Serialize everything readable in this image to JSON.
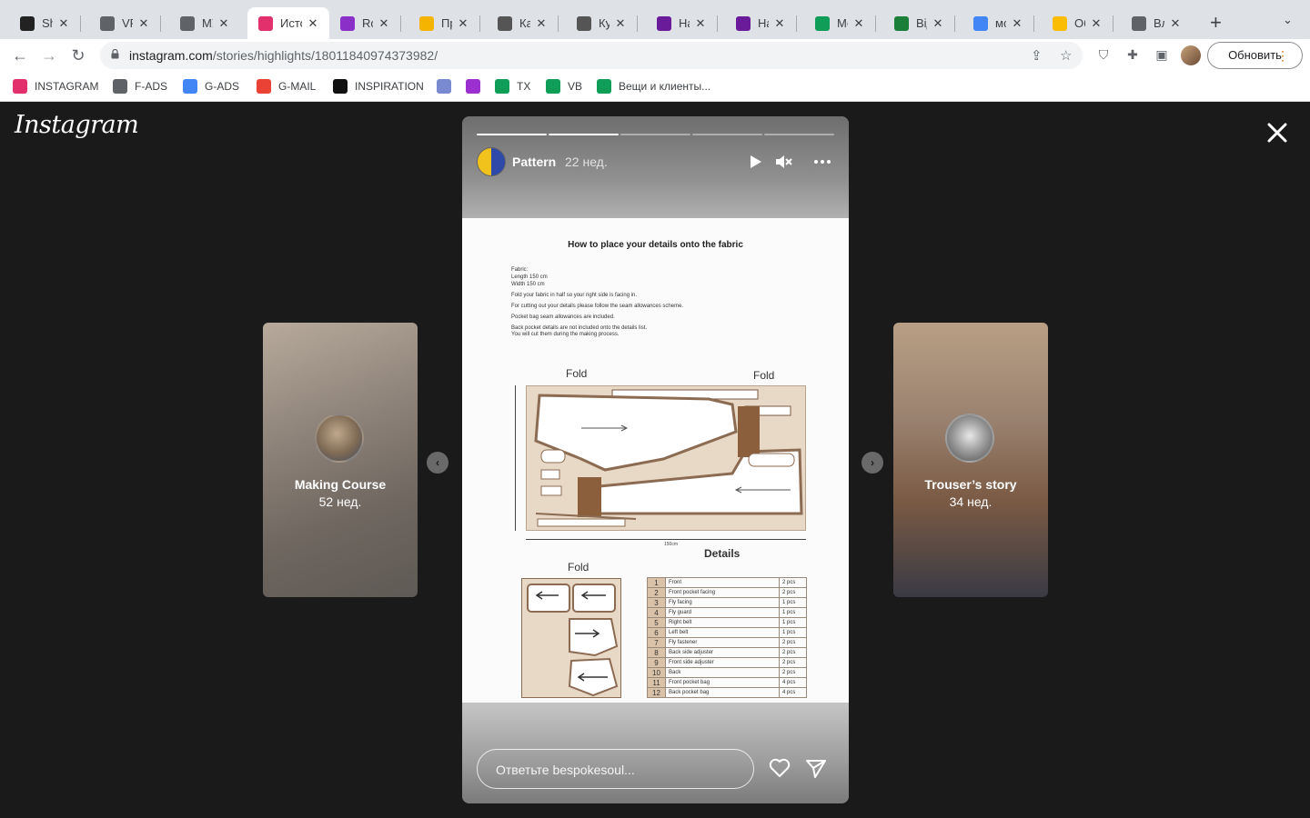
{
  "tabs": [
    {
      "title": "Shopify",
      "favicon": "shopify-icon",
      "color": "#222222"
    },
    {
      "title": "VFS",
      "favicon": "globe-icon",
      "color": "#5f6368"
    },
    {
      "title": "МУЖ",
      "favicon": "mic-icon",
      "color": "#5f6368"
    },
    {
      "title": "Истории",
      "favicon": "instagram-icon",
      "color": "#e1306c"
    },
    {
      "title": "Rok",
      "favicon": "rok-icon",
      "color": "#8b2fc9"
    },
    {
      "title": "Про",
      "favicon": "drive-icon",
      "color": "#f4b400"
    },
    {
      "title": "Кат",
      "favicon": "atk-icon",
      "color": "#555555"
    },
    {
      "title": "Куп",
      "favicon": "atk-icon",
      "color": "#555555"
    },
    {
      "title": "Нат",
      "favicon": "square-icon",
      "color": "#6a1b9a"
    },
    {
      "title": "Нат",
      "favicon": "square-icon",
      "color": "#6a1b9a"
    },
    {
      "title": "Мой",
      "favicon": "drive-icon",
      "color": "#0f9d58"
    },
    {
      "title": "Відг",
      "favicon": "leaf-icon",
      "color": "#1b7f3a"
    },
    {
      "title": "мош",
      "favicon": "google-icon",
      "color": "#4285f4"
    },
    {
      "title": "Объ",
      "favicon": "ads-icon",
      "color": "#fbbc04"
    },
    {
      "title": "Вла",
      "favicon": "globe-icon",
      "color": "#5f6368"
    }
  ],
  "address": {
    "host": "instagram.com",
    "path": "/stories/highlights/18011840974373982/"
  },
  "toolbar": {
    "update_label": "Обновить"
  },
  "bookmarks": [
    {
      "label": "INSTAGRAM",
      "icon": "instagram-icon",
      "color": "#e1306c"
    },
    {
      "label": "F-ADS",
      "icon": "fads-icon",
      "color": "#5f6368"
    },
    {
      "label": "G-ADS",
      "icon": "google-ads-icon",
      "color": "#4285f4"
    },
    {
      "label": "G-MAIL",
      "icon": "gmail-icon",
      "color": "#ea4335"
    },
    {
      "label": "INSPIRATION",
      "icon": "behance-icon",
      "color": "#111111"
    },
    {
      "label": "",
      "icon": "info-icon",
      "color": "#7a8ad0"
    },
    {
      "label": "",
      "icon": "bookmark-icon",
      "color": "#9b2fd0"
    },
    {
      "label": "TX",
      "icon": "drive-icon",
      "color": "#0f9d58"
    },
    {
      "label": "VB",
      "icon": "drive-icon",
      "color": "#0f9d58"
    },
    {
      "label": "Вещи и клиенты...",
      "icon": "sheets-icon",
      "color": "#0f9d58"
    }
  ],
  "viewer": {
    "logo": "Instagram",
    "left_story": {
      "name": "Making Course",
      "time": "52 нед."
    },
    "right_story": {
      "name": "Trouser’s story",
      "time": "34 нед."
    },
    "story": {
      "username": "Pattern",
      "time": "22 нед.",
      "progress_total": 5,
      "progress_done": 2,
      "reply_placeholder": "Ответьте bespokesoul..."
    }
  },
  "document": {
    "title": "How to place your details onto the fabric",
    "fabric": "Fabric:\nLength 150 cm\nWidth 150 cm",
    "instructions": [
      "Fold your fabric in half so your right side is facing in.",
      "For cutting out your details please follow the seam allowances scheme.",
      "Pocket bag seam allowances are included.",
      "Back pocket details are not included onto the details list.\nYou will cut them during the making process."
    ],
    "fold_labels": [
      "Fold",
      "Fold",
      "Fold"
    ],
    "width_label": "150cm",
    "details_title": "Details",
    "details": [
      {
        "n": "1",
        "name": "Front",
        "qty": "2 pcs"
      },
      {
        "n": "2",
        "name": "Front pocket facing",
        "qty": "2 pcs"
      },
      {
        "n": "3",
        "name": "Fly facing",
        "qty": "1 pcs"
      },
      {
        "n": "4",
        "name": "Fly guard",
        "qty": "1 pcs"
      },
      {
        "n": "5",
        "name": "Right belt",
        "qty": "1 pcs"
      },
      {
        "n": "6",
        "name": "Left belt",
        "qty": "1 pcs"
      },
      {
        "n": "7",
        "name": "Fly fastener",
        "qty": "2 pcs"
      },
      {
        "n": "8",
        "name": "Back side adjuster",
        "qty": "2 pcs"
      },
      {
        "n": "9",
        "name": "Front side adjuster",
        "qty": "2 pcs"
      },
      {
        "n": "10",
        "name": "Back",
        "qty": "2 pcs"
      },
      {
        "n": "11",
        "name": "Front pocket bag",
        "qty": "4 pcs"
      },
      {
        "n": "12",
        "name": "Back pocket bag",
        "qty": "4 pcs"
      }
    ]
  }
}
